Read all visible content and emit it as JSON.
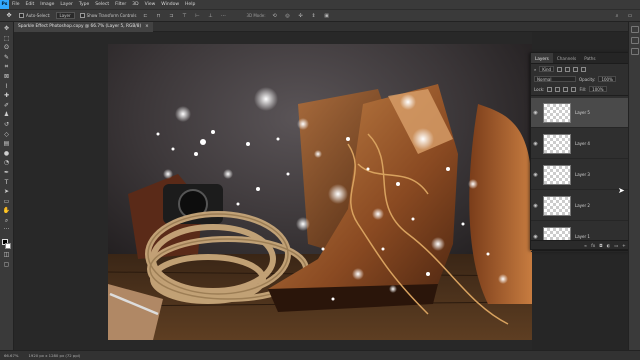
{
  "app": {
    "logo": "Ps"
  },
  "menu": [
    "File",
    "Edit",
    "Image",
    "Layer",
    "Type",
    "Select",
    "Filter",
    "3D",
    "View",
    "Window",
    "Help"
  ],
  "options": {
    "auto_select_label": "Auto-Select:",
    "auto_select_value": "Layer",
    "transform_controls_label": "Show Transform Controls",
    "three_d_mode_label": "3D Mode:"
  },
  "document_tab": {
    "title": "Sparkle Effect Photoshop.copy @ 66.7% (Layer 5, RGB/8)",
    "close": "×"
  },
  "status": {
    "zoom": "66.67%",
    "doc_info": "1920 px x 1280 px (72 ppi)"
  },
  "layers_panel": {
    "tabs": [
      "Layers",
      "Channels",
      "Paths"
    ],
    "active_tab": "Layers",
    "filter_label": "Kind",
    "blend_mode": "Normal",
    "opacity_label": "Opacity:",
    "opacity_value": "100%",
    "lock_label": "Lock:",
    "fill_label": "Fill:",
    "fill_value": "100%",
    "layers": [
      {
        "name": "Layer 5",
        "selected": true
      },
      {
        "name": "Layer 4",
        "selected": false
      },
      {
        "name": "Layer 3",
        "selected": false
      },
      {
        "name": "Layer 2",
        "selected": false
      },
      {
        "name": "Layer 1",
        "selected": false
      }
    ],
    "footer_icons": [
      "link-icon",
      "fx-icon",
      "mask-icon",
      "adjustment-icon",
      "folder-icon",
      "new-layer-icon",
      "trash-icon"
    ],
    "footer_glyphs": [
      "∞",
      "fx",
      "◘",
      "◐",
      "▭",
      "+",
      "🗑"
    ]
  },
  "colors": {
    "chrome": "#3a3a3a",
    "workspace": "#282828",
    "panel": "#2f2f2f",
    "selected_layer": "#4a4a4a",
    "brand": "#31a8ff"
  }
}
